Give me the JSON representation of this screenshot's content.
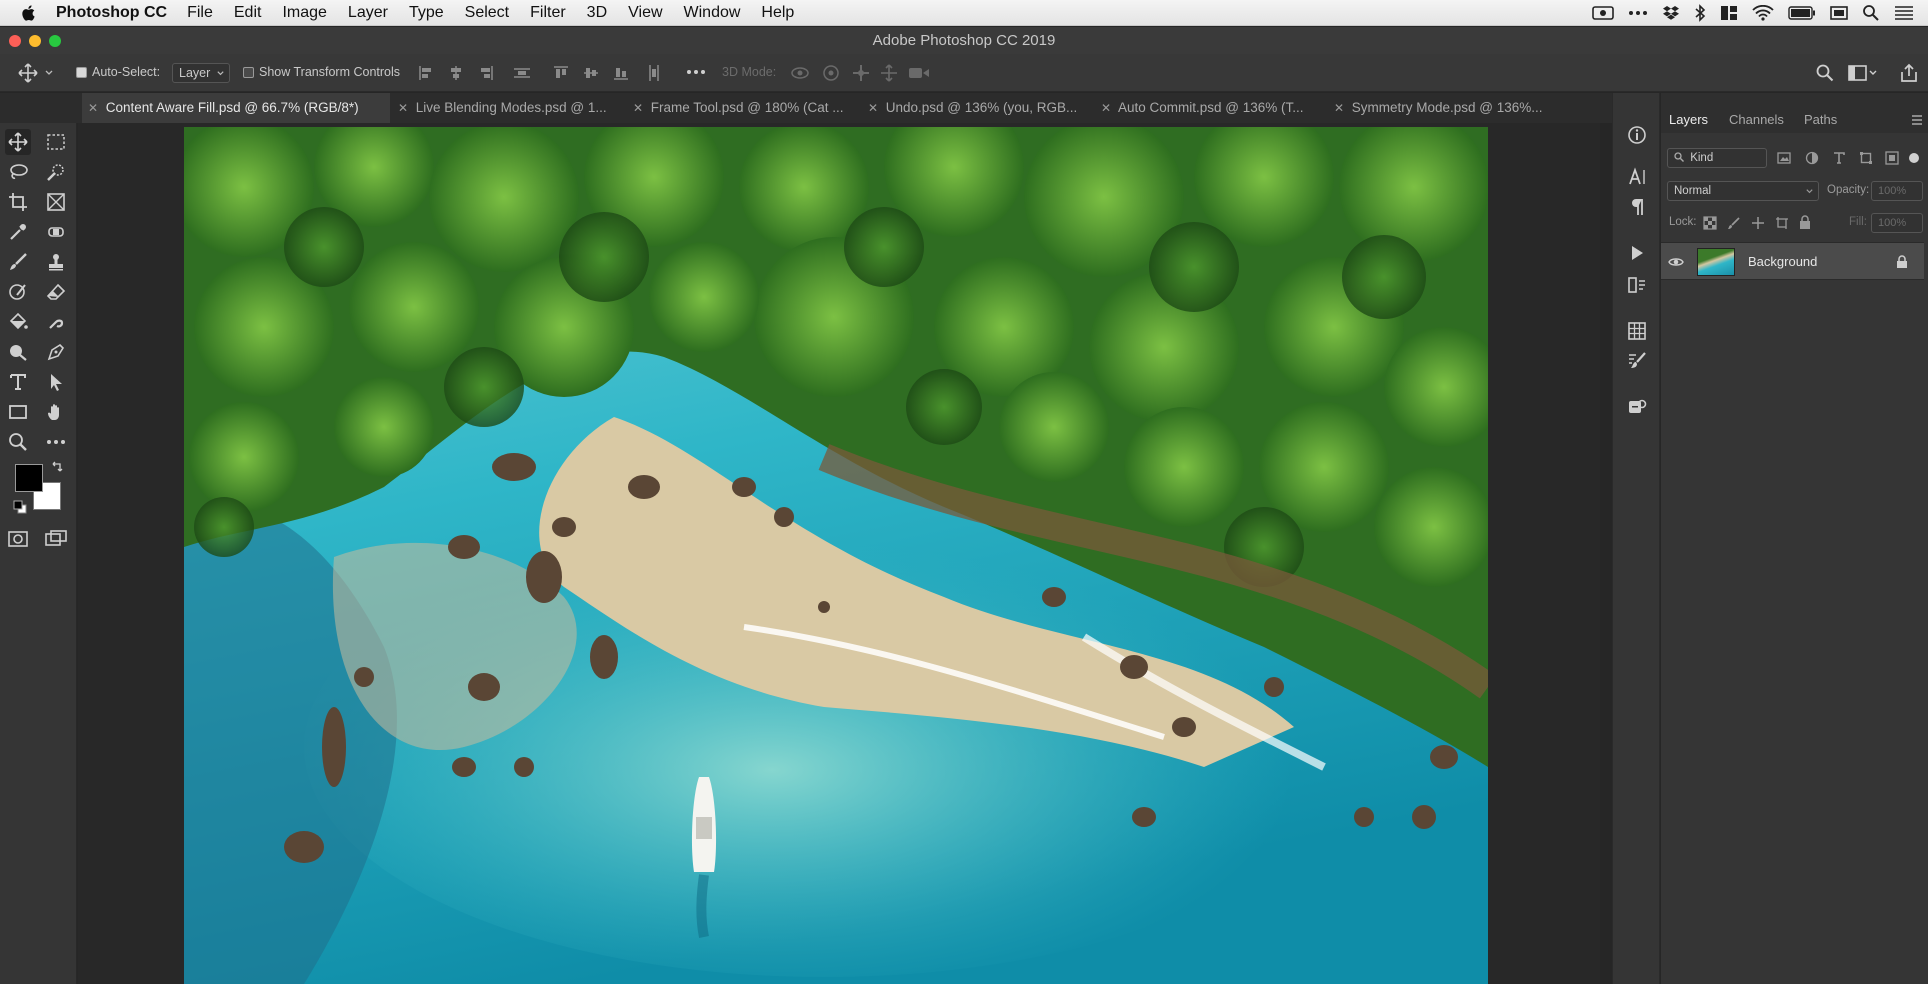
{
  "menubar": {
    "app_name": "Photoshop CC",
    "menus": [
      "File",
      "Edit",
      "Image",
      "Layer",
      "Type",
      "Select",
      "Filter",
      "3D",
      "View",
      "Window",
      "Help"
    ]
  },
  "window": {
    "title": "Adobe Photoshop CC 2019"
  },
  "options": {
    "auto_select_label": "Auto-Select:",
    "auto_select_checked": true,
    "auto_select_target": "Layer",
    "show_transform_label": "Show Transform Controls",
    "show_transform_checked": false,
    "mode_3d_label": "3D Mode:"
  },
  "tabs": [
    {
      "label": "Content Aware Fill.psd @ 66.7% (RGB/8*)",
      "active": true
    },
    {
      "label": "Live Blending Modes.psd @ 1...",
      "active": false
    },
    {
      "label": "Frame Tool.psd @ 180% (Cat ...",
      "active": false
    },
    {
      "label": "Undo.psd @ 136% (you, RGB...",
      "active": false
    },
    {
      "label": "Auto Commit.psd @ 136% (T...",
      "active": false
    },
    {
      "label": "Symmetry Mode.psd @ 136%...",
      "active": false
    }
  ],
  "layers_panel": {
    "tabs": [
      "Layers",
      "Channels",
      "Paths"
    ],
    "active_tab": "Layers",
    "filter_kind": "Kind",
    "blend_mode": "Normal",
    "opacity_label": "Opacity:",
    "opacity_value": "100%",
    "lock_label": "Lock:",
    "fill_label": "Fill:",
    "fill_value": "100%",
    "layers": [
      {
        "name": "Background",
        "visible": true,
        "locked": true
      }
    ]
  },
  "colors": {
    "foreground": "#000000",
    "background": "#ffffff",
    "ui_dark": "#353535",
    "canvas_bg": "#282828"
  }
}
